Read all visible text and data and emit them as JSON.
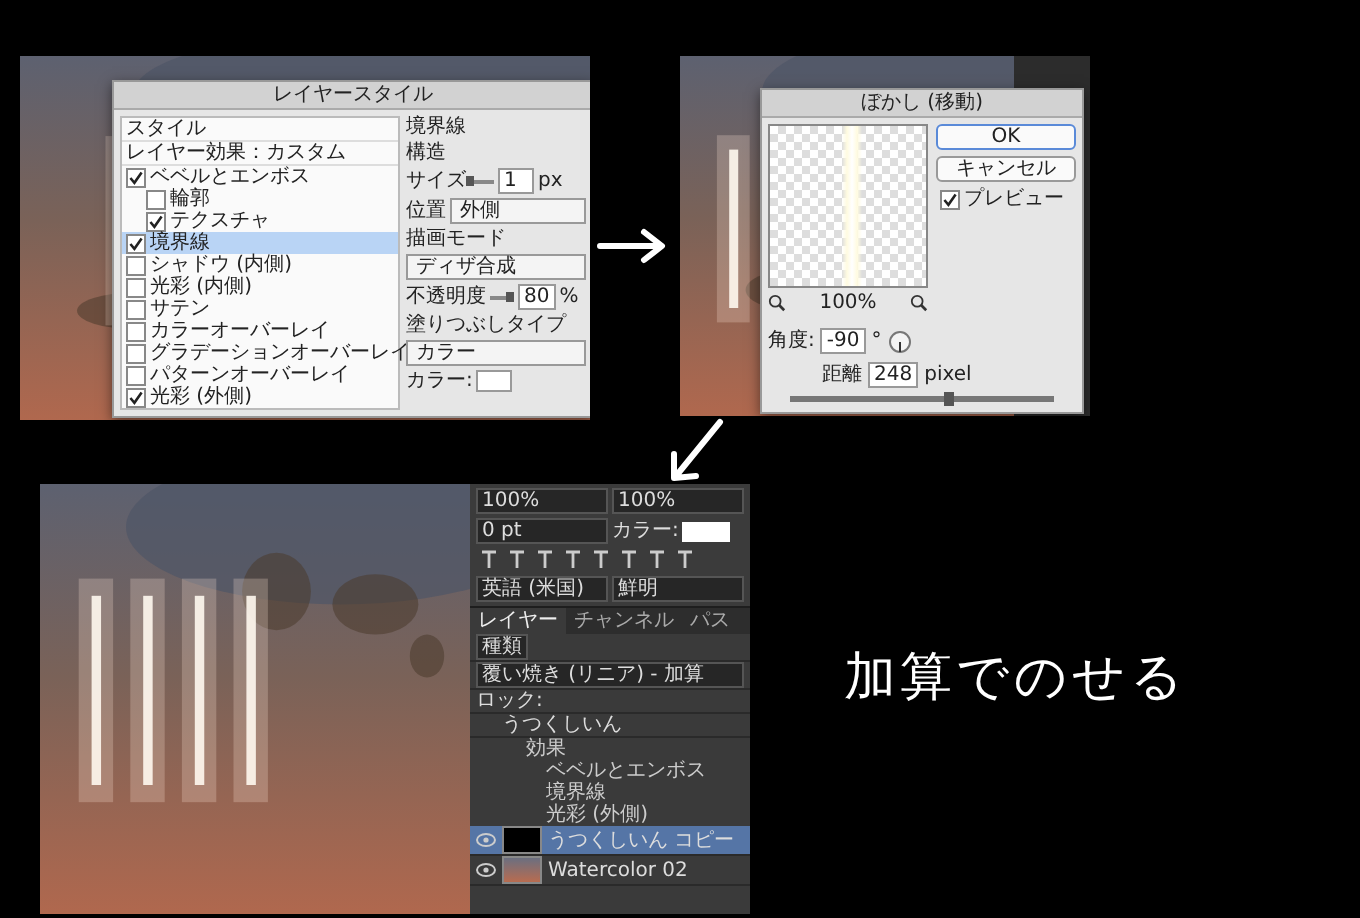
{
  "step_1": {
    "dialog": {
      "title": "レイヤースタイル",
      "styles_header": "スタイル",
      "blend_item": "レイヤー効果：カスタム",
      "effects": [
        {
          "label": "ベベルとエンボス",
          "checked": true,
          "selected": false,
          "children": [
            {
              "label": "輪郭",
              "checked": false,
              "selected": false
            },
            {
              "label": "テクスチャ",
              "checked": true,
              "selected": false
            }
          ]
        },
        {
          "label": "境界線",
          "checked": true,
          "selected": true
        },
        {
          "label": "シャドウ (内側)",
          "checked": false,
          "selected": false
        },
        {
          "label": "光彩 (内側)",
          "checked": false,
          "selected": false
        },
        {
          "label": "サテン",
          "checked": false,
          "selected": false
        },
        {
          "label": "カラーオーバーレイ",
          "checked": false,
          "selected": false
        },
        {
          "label": "グラデーションオーバーレイ",
          "checked": false,
          "selected": false
        },
        {
          "label": "パターンオーバーレイ",
          "checked": false,
          "selected": false
        },
        {
          "label": "光彩 (外側)",
          "checked": true,
          "selected": false
        }
      ],
      "section": "境界線",
      "group": "構造",
      "fields": [
        {
          "kind": "slider",
          "label": "サイズ",
          "value": "1",
          "unit": "px",
          "level": 0.03
        },
        {
          "kind": "select",
          "label": "位置",
          "value": "外側"
        },
        {
          "kind": "select",
          "label": "描画モード",
          "value": "ディザ合成"
        },
        {
          "kind": "slider",
          "label": "不透明度",
          "value": "80",
          "unit": "%",
          "level": 0.8
        },
        {
          "kind": "select",
          "label": "塗りつぶしタイプ",
          "value": "カラー"
        },
        {
          "kind": "swatch",
          "label": "カラー:"
        }
      ]
    }
  },
  "step_2": {
    "dialog": {
      "title": "ぼかし (移動)",
      "buttons": [
        "OK",
        "キャンセル"
      ],
      "preview": {
        "label": "プレビュー",
        "checked": true
      },
      "zoom": "100%",
      "angle": {
        "label": "角度:",
        "value": "-90",
        "unit": "°"
      },
      "distance": {
        "label": "距離",
        "value": "248",
        "unit": "pixel",
        "level": 0.6
      }
    }
  },
  "step_3": {
    "character": {
      "fields": [
        "100%",
        "100%",
        "0 pt"
      ],
      "color_label": "カラー:",
      "language": "英語 (米国)",
      "antialias": "鮮明"
    },
    "layers": {
      "tabs": [
        {
          "label": "レイヤー",
          "selected": true
        },
        {
          "label": "チャンネル",
          "selected": false
        },
        {
          "label": "パス",
          "selected": false
        }
      ],
      "filter": "種類",
      "blend_mode": "覆い焼き (リニア) - 加算",
      "lock_label": "ロック:",
      "items": [
        {
          "name": "うつくしいん",
          "kind": "group",
          "visible": false,
          "selected": false,
          "effects_label": "効果",
          "effects": [
            "ベベルとエンボス",
            "境界線",
            "光彩 (外側)"
          ]
        },
        {
          "name": "うつくしいん コピー",
          "kind": "dark",
          "visible": true,
          "selected": true
        },
        {
          "name": "Watercolor 02",
          "kind": "paint",
          "visible": true,
          "selected": false
        }
      ]
    }
  },
  "caption": "加算でのせる"
}
